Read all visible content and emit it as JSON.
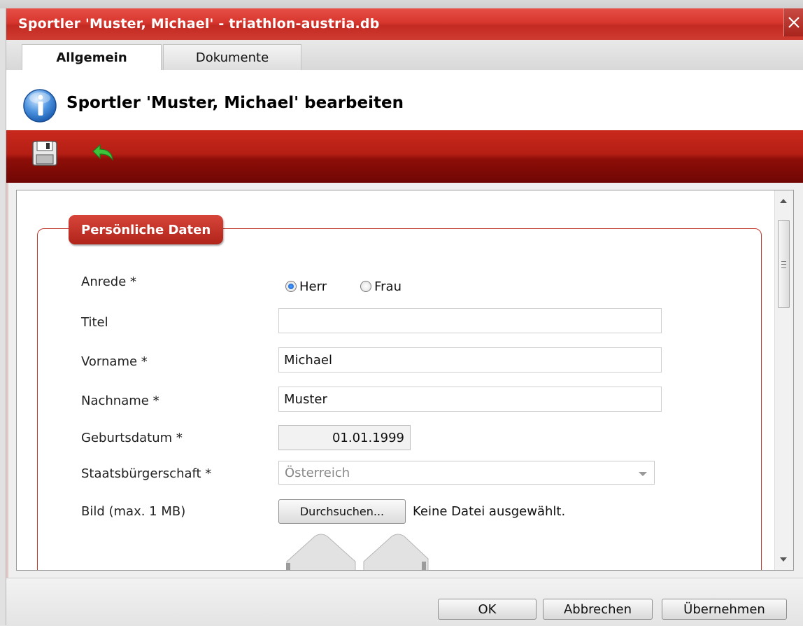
{
  "window": {
    "title": "Sportler 'Muster, Michael' - triathlon-austria.db",
    "close_icon": "close-icon"
  },
  "tabs": [
    {
      "label": "Allgemein",
      "active": true
    },
    {
      "label": "Dokumente",
      "active": false
    }
  ],
  "header": {
    "icon": "info-icon",
    "title": "Sportler 'Muster, Michael' bearbeiten"
  },
  "toolbar": {
    "icons": [
      "save-icon",
      "back-arrow-icon"
    ]
  },
  "form": {
    "legend": "Persönliche Daten",
    "anrede": {
      "label": "Anrede *",
      "options": [
        {
          "label": "Herr",
          "checked": true
        },
        {
          "label": "Frau",
          "checked": false
        }
      ]
    },
    "titel": {
      "label": "Titel",
      "value": ""
    },
    "vorname": {
      "label": "Vorname *",
      "value": "Michael"
    },
    "nachname": {
      "label": "Nachname *",
      "value": "Muster"
    },
    "geburtsdatum": {
      "label": "Geburtsdatum *",
      "value": "01.01.1999"
    },
    "staatsbuergerschaft": {
      "label": "Staatsbürgerschaft *",
      "value": "Österreich"
    },
    "bild": {
      "label": "Bild (max. 1 MB)",
      "button_label": "Durchsuchen...",
      "status": "Keine Datei ausgewählt."
    }
  },
  "footer": {
    "ok_label": "OK",
    "cancel_label": "Abbrechen",
    "apply_label": "Übernehmen"
  },
  "colors": {
    "accent_red": "#c32a22",
    "toolbar_dark_red": "#6f0604",
    "border_red": "#c0392b"
  }
}
